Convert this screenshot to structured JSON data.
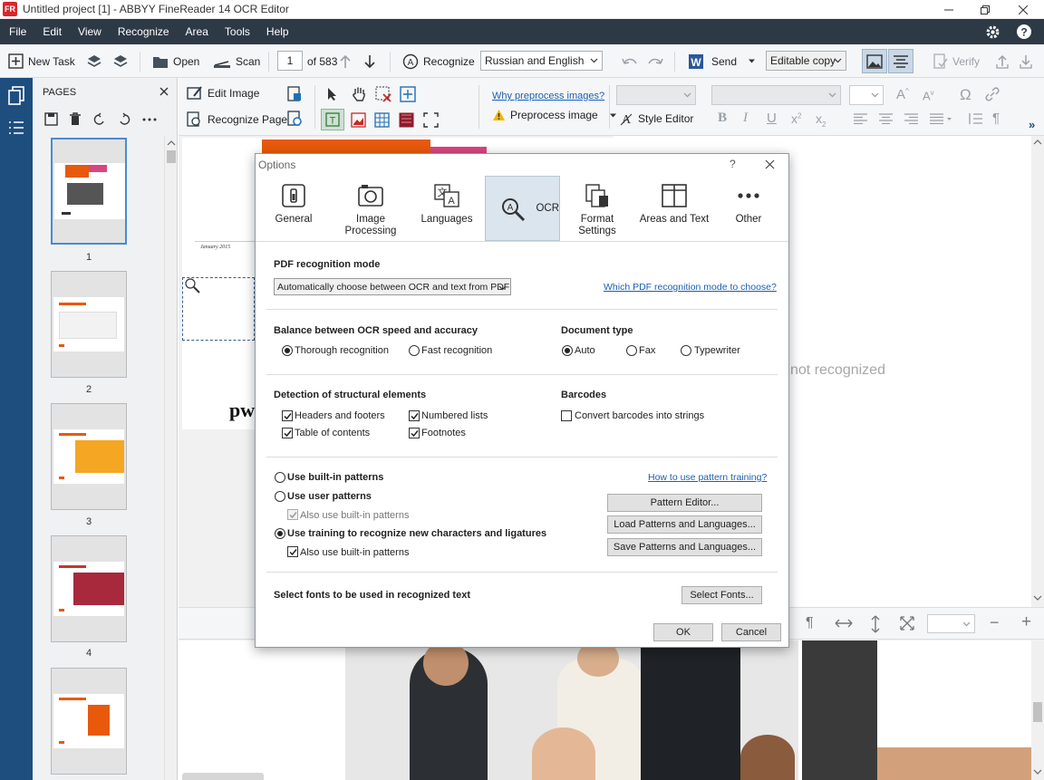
{
  "window": {
    "title": "Untitled project [1] - ABBYY FineReader 14 OCR Editor",
    "app_icon_text": "FR"
  },
  "menu": [
    "File",
    "Edit",
    "View",
    "Recognize",
    "Area",
    "Tools",
    "Help"
  ],
  "toolbar": {
    "new_task": "New Task",
    "open": "Open",
    "scan": "Scan",
    "page_current": "1",
    "page_total": "of 583",
    "recognize": "Recognize",
    "language": "Russian and English",
    "send": "Send",
    "output_mode": "Editable copy",
    "verify": "Verify"
  },
  "pages_panel": {
    "title": "PAGES",
    "pages": [
      "1",
      "2",
      "3",
      "4"
    ]
  },
  "toolbar2": {
    "edit_image": "Edit Image",
    "recognize_page": "Recognize Page",
    "why_preprocess": "Why preprocess images?",
    "preprocess_image": "Preprocess image",
    "style_editor": "Style Editor"
  },
  "canvas": {
    "doc_date": "January 2015",
    "doc_logo": "pw",
    "not_recognized": "not recognized"
  },
  "dialog": {
    "title": "Options",
    "help": "?",
    "tabs": [
      {
        "label": "General",
        "icon": "general-icon"
      },
      {
        "label": "Image Processing",
        "icon": "camera-icon"
      },
      {
        "label": "Languages",
        "icon": "languages-icon"
      },
      {
        "label": "OCR",
        "icon": "ocr-magnifier-icon"
      },
      {
        "label": "Format Settings",
        "icon": "format-settings-icon"
      },
      {
        "label": "Areas and Text",
        "icon": "areas-icon"
      },
      {
        "label": "Other",
        "icon": "more-icon"
      }
    ],
    "pdf_mode_label": "PDF recognition mode",
    "pdf_mode_value": "Automatically choose between OCR and text from PDF",
    "pdf_mode_link": "Which PDF recognition mode to choose?",
    "balance_label": "Balance between OCR speed and accuracy",
    "thorough": "Thorough recognition",
    "fast": "Fast recognition",
    "doc_type_label": "Document type",
    "auto": "Auto",
    "fax": "Fax",
    "typewriter": "Typewriter",
    "structural_label": "Detection of structural elements",
    "headers_footers": "Headers and footers",
    "table_of_contents": "Table of contents",
    "numbered_lists": "Numbered lists",
    "footnotes": "Footnotes",
    "barcodes_label": "Barcodes",
    "convert_barcodes": "Convert barcodes into strings",
    "use_builtin": "Use built-in patterns",
    "use_user": "Use user patterns",
    "also_builtin_1": "Also use built-in patterns",
    "use_training": "Use training to recognize new characters and ligatures",
    "also_builtin_2": "Also use built-in patterns",
    "pattern_link": "How to use pattern training?",
    "pattern_editor": "Pattern Editor...",
    "load_patterns": "Load Patterns and Languages...",
    "save_patterns": "Save Patterns and Languages...",
    "fonts_label": "Select fonts to be used in recognized text",
    "select_fonts": "Select Fonts...",
    "ok": "OK",
    "cancel": "Cancel"
  },
  "colors": {
    "menubar": "#2d3a46",
    "sidebar": "#1d4e7e",
    "link": "#1a5fb4",
    "accent_orange": "#e8590c",
    "accent_pink": "#d9467f"
  }
}
